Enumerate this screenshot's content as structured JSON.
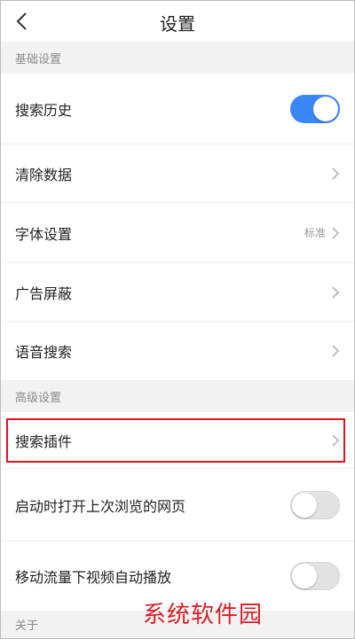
{
  "header": {
    "title": "设置"
  },
  "sections": {
    "basic": "基础设置",
    "advanced": "高级设置",
    "about": "关于"
  },
  "rows": {
    "search_history": {
      "label": "搜索历史",
      "toggle": "on"
    },
    "clear_data": {
      "label": "清除数据"
    },
    "font_settings": {
      "label": "字体设置",
      "value": "标准"
    },
    "ad_block": {
      "label": "广告屏蔽"
    },
    "voice_search": {
      "label": "语音搜索"
    },
    "search_plugin": {
      "label": "搜索插件"
    },
    "open_last_page": {
      "label": "启动时打开上次浏览的网页",
      "toggle": "off"
    },
    "mobile_autoplay": {
      "label": "移动流量下视频自动播放",
      "toggle": "off"
    }
  },
  "colors": {
    "accent": "#3b86f7",
    "highlight_border": "#e0141c",
    "watermark": "#d71f28"
  },
  "watermark": "系统软件园"
}
